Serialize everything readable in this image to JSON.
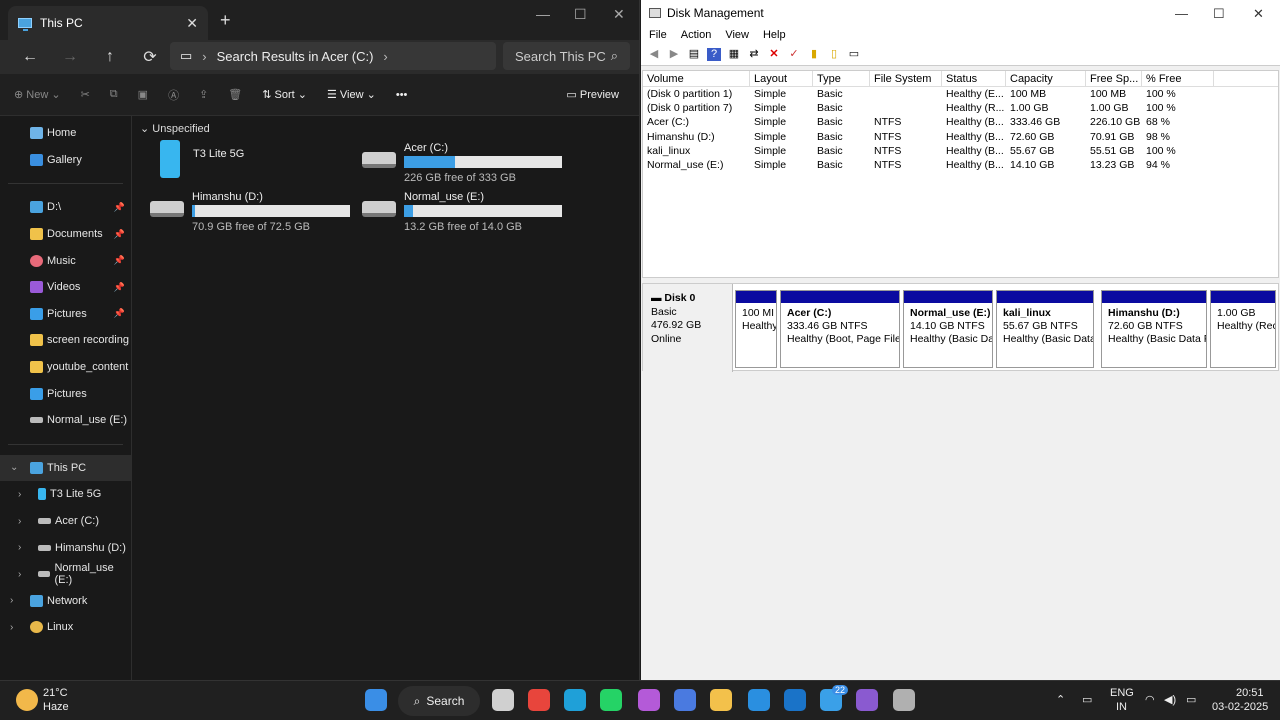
{
  "explorer": {
    "tab_title": "This PC",
    "close": "✕",
    "new_tab": "+",
    "window_controls": [
      "—",
      "☐",
      "✕"
    ],
    "address": "Search Results in Acer (C:)",
    "search_placeholder": "Search This PC",
    "toolbar": {
      "new": "New",
      "sort": "Sort",
      "view": "View",
      "more": "•••",
      "preview": "Preview"
    },
    "sidebar": [
      {
        "label": "Home",
        "icon": "home-icon",
        "pinned": false
      },
      {
        "label": "Gallery",
        "icon": "gallery-icon",
        "pinned": false
      },
      {
        "label": "D:\\",
        "icon": "download-icon",
        "pinned": true
      },
      {
        "label": "Documents",
        "icon": "folder-icon",
        "pinned": true
      },
      {
        "label": "Music",
        "icon": "music-icon",
        "pinned": true
      },
      {
        "label": "Videos",
        "icon": "videos-icon",
        "pinned": true
      },
      {
        "label": "Pictures",
        "icon": "pictures-icon",
        "pinned": true
      },
      {
        "label": "screen recording",
        "icon": "folder-icon",
        "pinned": false
      },
      {
        "label": "youtube_content",
        "icon": "folder-icon",
        "pinned": false
      },
      {
        "label": "Pictures",
        "icon": "pictures-icon",
        "pinned": false
      },
      {
        "label": "Normal_use (E:)",
        "icon": "drive-icon",
        "pinned": false
      }
    ],
    "tree": [
      {
        "label": "This PC",
        "expanded": true
      },
      {
        "label": "T3 Lite 5G"
      },
      {
        "label": "Acer (C:)"
      },
      {
        "label": "Himanshu (D:)"
      },
      {
        "label": "Normal_use (E:)"
      },
      {
        "label": "Network"
      },
      {
        "label": "Linux"
      }
    ],
    "group": "Unspecified",
    "device": "T3 Lite 5G",
    "drives": [
      {
        "name": "Acer (C:)",
        "free": "226 GB free of 333 GB",
        "used_fraction": 0.32
      },
      {
        "name": "Himanshu (D:)",
        "free": "70.9 GB free of 72.5 GB",
        "used_fraction": 0.02
      },
      {
        "name": "Normal_use (E:)",
        "free": "13.2 GB free of 14.0 GB",
        "used_fraction": 0.06
      }
    ]
  },
  "diskmgmt": {
    "title": "Disk Management",
    "menu": [
      "File",
      "Action",
      "View",
      "Help"
    ],
    "window_controls": [
      "—",
      "☐",
      "✕"
    ],
    "columns": [
      "Volume",
      "Layout",
      "Type",
      "File System",
      "Status",
      "Capacity",
      "Free Sp...",
      "% Free"
    ],
    "rows": [
      [
        "(Disk 0 partition 1)",
        "Simple",
        "Basic",
        "",
        "Healthy (E...",
        "100 MB",
        "100 MB",
        "100 %"
      ],
      [
        "(Disk 0 partition 7)",
        "Simple",
        "Basic",
        "",
        "Healthy (R...",
        "1.00 GB",
        "1.00 GB",
        "100 %"
      ],
      [
        "Acer (C:)",
        "Simple",
        "Basic",
        "NTFS",
        "Healthy (B...",
        "333.46 GB",
        "226.10 GB",
        "68 %"
      ],
      [
        "Himanshu (D:)",
        "Simple",
        "Basic",
        "NTFS",
        "Healthy (B...",
        "72.60 GB",
        "70.91 GB",
        "98 %"
      ],
      [
        "kali_linux",
        "Simple",
        "Basic",
        "NTFS",
        "Healthy (B...",
        "55.67 GB",
        "55.51 GB",
        "100 %"
      ],
      [
        "Normal_use (E:)",
        "Simple",
        "Basic",
        "NTFS",
        "Healthy (B...",
        "14.10 GB",
        "13.23 GB",
        "94 %"
      ]
    ],
    "disk": {
      "name": "Disk 0",
      "type": "Basic",
      "size": "476.92 GB",
      "state": "Online"
    },
    "partitions": [
      {
        "name": "",
        "size": "100 MI",
        "status": "Healthy"
      },
      {
        "name": "Acer  (C:)",
        "size": "333.46 GB NTFS",
        "status": "Healthy (Boot, Page File,"
      },
      {
        "name": "Normal_use  (E:)",
        "size": "14.10 GB NTFS",
        "status": "Healthy (Basic Dat"
      },
      {
        "name": "kali_linux",
        "size": "55.67 GB NTFS",
        "status": "Healthy (Basic Data P"
      },
      {
        "name": "Himanshu  (D:)",
        "size": "72.60 GB NTFS",
        "status": "Healthy (Basic Data P"
      },
      {
        "name": "",
        "size": "1.00 GB",
        "status": "Healthy (Rec"
      }
    ]
  },
  "taskbar": {
    "weather_temp": "21°C",
    "weather_desc": "Haze",
    "search": "Search",
    "badge": "22",
    "lang1": "ENG",
    "lang2": "IN",
    "time": "20:51",
    "date": "03-02-2025",
    "apps": [
      {
        "name": "start-button",
        "color": "#3a8ee6"
      },
      {
        "name": "task-view",
        "color": "#d0d0d0"
      },
      {
        "name": "chrome",
        "color": "#e8453c"
      },
      {
        "name": "edge",
        "color": "#1fa0d8"
      },
      {
        "name": "whatsapp",
        "color": "#25d366"
      },
      {
        "name": "copilot",
        "color": "#b45ad8"
      },
      {
        "name": "translate",
        "color": "#4a7ae0"
      },
      {
        "name": "file-explorer",
        "color": "#f3c14b"
      },
      {
        "name": "vscode",
        "color": "#2a8fe0"
      },
      {
        "name": "outlook",
        "color": "#1a73c8"
      },
      {
        "name": "mail",
        "color": "#3aa0e8"
      },
      {
        "name": "clipchamp",
        "color": "#8a5ad0"
      },
      {
        "name": "disk-mgmt",
        "color": "#b0b0b0"
      }
    ]
  }
}
